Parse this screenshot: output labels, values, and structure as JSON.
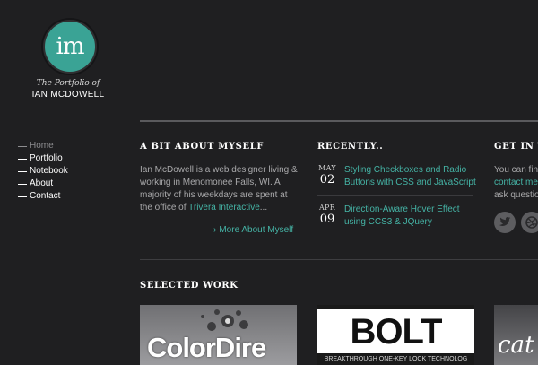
{
  "brand": {
    "monogram": "im",
    "tagline": "The Portfolio of",
    "name": "IAN MCDOWELL",
    "accent_color": "#3aa395"
  },
  "nav": {
    "items": [
      {
        "label": "Home",
        "active": true
      },
      {
        "label": "Portfolio",
        "active": false
      },
      {
        "label": "Notebook",
        "active": false
      },
      {
        "label": "About",
        "active": false
      },
      {
        "label": "Contact",
        "active": false
      }
    ]
  },
  "about": {
    "heading": "A BIT ABOUT MYSELF",
    "text_before": "Ian McDowell is a web designer living & working in Menomonee Falls, WI. A majority of his weekdays are spent at the office of ",
    "link": "Trivera Interactive",
    "text_after": "...",
    "more_link": "More About Myself"
  },
  "recently": {
    "heading": "RECENTLY..",
    "posts": [
      {
        "month": "MAY",
        "day": "02",
        "title": "Styling Checkboxes and Radio Buttons with CSS and JavaScript"
      },
      {
        "month": "APR",
        "day": "09",
        "title": "Direction-Aware Hover Effect using CCS3 & JQuery"
      }
    ]
  },
  "contact": {
    "heading": "GET IN TO",
    "line1": "You can fin",
    "line2_link": "contact me",
    "line3": "ask questio",
    "social_icons": [
      "twitter-icon",
      "dribbble-icon"
    ]
  },
  "work": {
    "heading": "SELECTED WORK",
    "items": [
      {
        "title": "ColorDire"
      },
      {
        "title": "BOLT",
        "tagline": "BREAKTHROUGH ONE-KEY LOCK TECHNOLOG"
      },
      {
        "title": "cat"
      }
    ]
  },
  "colors": {
    "background": "#1f1f21",
    "link": "#45b4a6",
    "text": "#a9a9ab",
    "heading": "#ffffff"
  }
}
